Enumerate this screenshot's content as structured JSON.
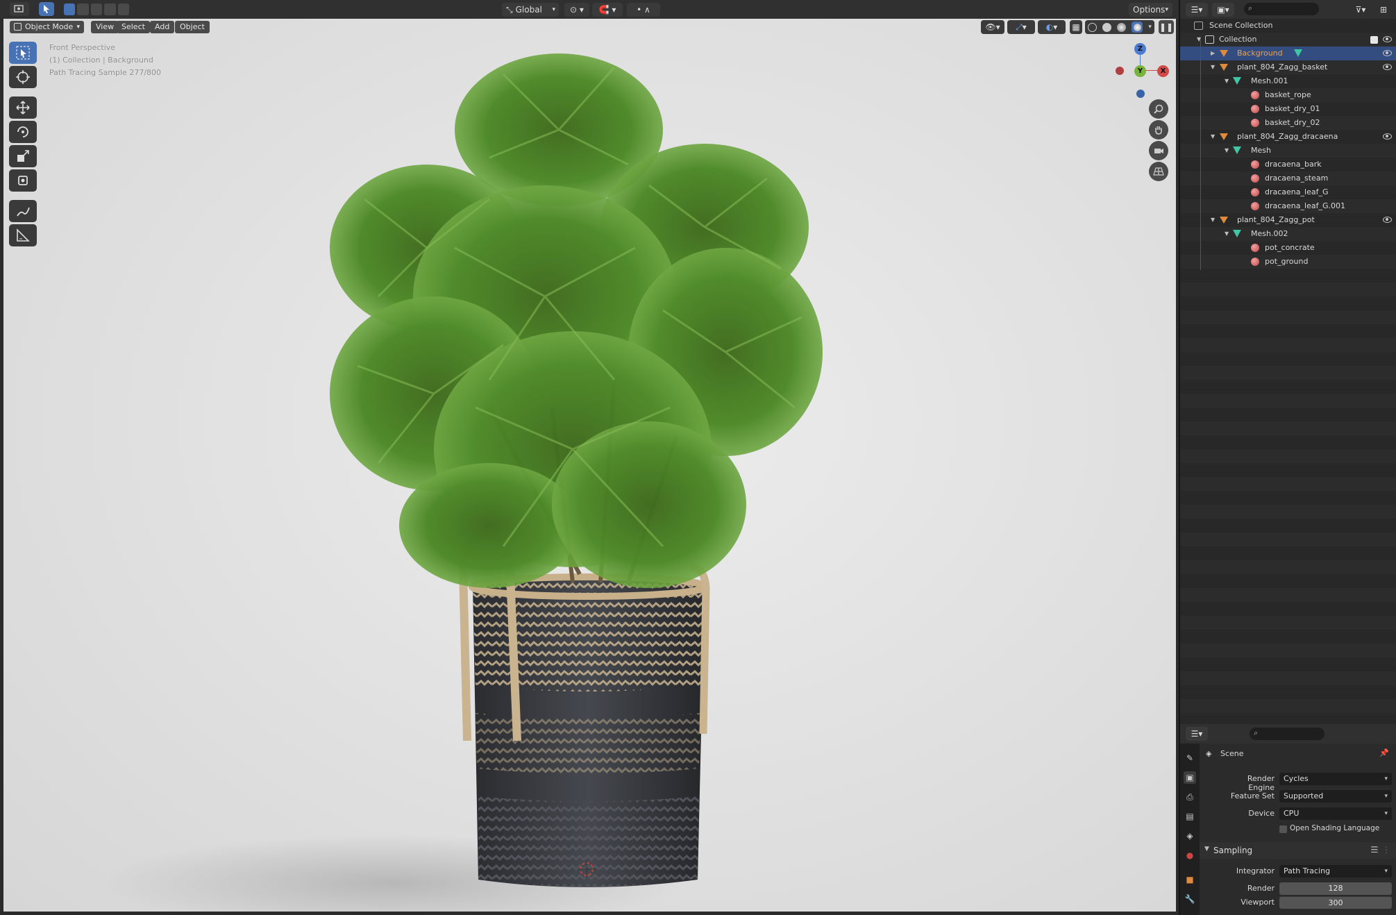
{
  "viewport": {
    "transform_orientation": "Global",
    "options_label": "Options",
    "mode": "Object Mode",
    "menus": [
      "View",
      "Select",
      "Add",
      "Object"
    ],
    "overlay_lines": [
      "Front Perspective",
      "(1) Collection | Background",
      "Path Tracing Sample 277/800"
    ],
    "gizmo_axes": {
      "z": "Z",
      "y": "Y",
      "x": "X"
    },
    "tools": [
      "select-box-icon",
      "cursor-icon",
      "move-icon",
      "rotate-icon",
      "scale-icon",
      "transform-icon",
      "annotate-icon",
      "measure-icon"
    ]
  },
  "outliner": {
    "root": "Scene Collection",
    "items": [
      {
        "label": "Collection",
        "type": "collection"
      },
      {
        "label": "Background",
        "type": "object",
        "selected": true
      },
      {
        "label": "plant_804_Zagg_basket",
        "type": "object"
      },
      {
        "label": "Mesh.001",
        "type": "mesh"
      },
      {
        "label": "basket_rope",
        "type": "material"
      },
      {
        "label": "basket_dry_01",
        "type": "material"
      },
      {
        "label": "basket_dry_02",
        "type": "material"
      },
      {
        "label": "plant_804_Zagg_dracaena",
        "type": "object"
      },
      {
        "label": "Mesh",
        "type": "mesh"
      },
      {
        "label": "dracaena_bark",
        "type": "material"
      },
      {
        "label": "dracaena_steam",
        "type": "material"
      },
      {
        "label": "dracaena_leaf_G",
        "type": "material"
      },
      {
        "label": "dracaena_leaf_G.001",
        "type": "material"
      },
      {
        "label": "plant_804_Zagg_pot",
        "type": "object"
      },
      {
        "label": "Mesh.002",
        "type": "mesh"
      },
      {
        "label": "pot_concrate",
        "type": "material"
      },
      {
        "label": "pot_ground",
        "type": "material"
      }
    ]
  },
  "properties": {
    "context": "Scene",
    "render_engine_label": "Render Engine",
    "render_engine": "Cycles",
    "feature_set_label": "Feature Set",
    "feature_set": "Supported",
    "device_label": "Device",
    "device": "CPU",
    "osl_label": "Open Shading Language",
    "sampling_label": "Sampling",
    "integrator_label": "Integrator",
    "integrator": "Path Tracing",
    "render_label": "Render",
    "render_samples": "128",
    "viewport_label": "Viewport",
    "viewport_samples": "300"
  },
  "colors": {
    "selection": "#334d80",
    "active_tool": "#4772b3",
    "object_icon": "#e08a3c",
    "mesh_icon": "#3ec6a5",
    "material_icon": "#c04848"
  }
}
